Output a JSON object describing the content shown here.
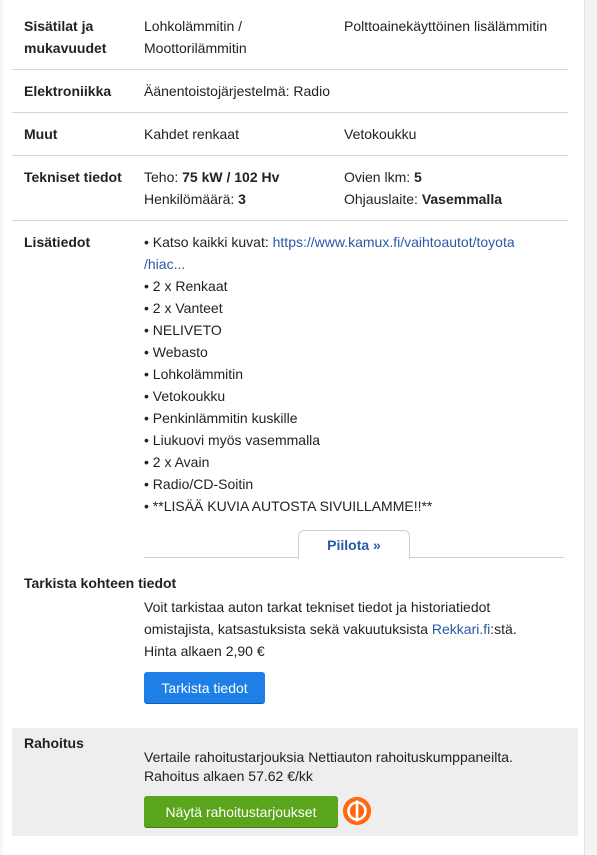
{
  "specs": {
    "interior": {
      "label_line1": "Sisätilat ja",
      "label_line2": "mukavuudet",
      "col1_line1": "Lohkolämmitin /",
      "col1_line2": "Moottorilämmitin",
      "col2": "Polttoainekäyttöinen lisälämmitin"
    },
    "electronics": {
      "label": "Elektroniikka",
      "value": "Äänentoistojärjestelmä: Radio"
    },
    "misc": {
      "label": "Muut",
      "col1": "Kahdet renkaat",
      "col2": "Vetokoukku"
    },
    "technical": {
      "label": "Tekniset tiedot",
      "power_label": "Teho:",
      "power_value": "75 kW / 102 Hv",
      "doors_label": "Ovien lkm:",
      "doors_value": "5",
      "persons_label": "Henkilömäärä:",
      "persons_value": "3",
      "steering_label": "Ohjauslaite:",
      "steering_value": "Vasemmalla"
    },
    "extra": {
      "label": "Lisätiedot",
      "link_prefix": "• Katso kaikki kuvat: ",
      "link_line1": "https://www.kamux.fi/vaihtoautot/toyota",
      "link_line2": "/hiac...",
      "items": [
        "• 2 x Renkaat",
        "• 2 x Vanteet",
        "• NELIVETO",
        "• Webasto",
        "• Lohkolämmitin",
        "• Vetokoukku",
        "• Penkinlämmitin kuskille",
        "• Liukuovi myös vasemmalla",
        "• 2 x Avain",
        "• Radio/CD-Soitin",
        "• **LISÄÄ KUVIA AUTOSTA SIVUILLAMME!!**"
      ],
      "hide_tab": "Piilota »"
    }
  },
  "check": {
    "title": "Tarkista kohteen tiedot",
    "line1": "Voit tarkistaa auton tarkat tekniset tiedot ja historiatiedot",
    "line2_prefix": "omistajista, katsastuksista sekä vakuutuksista ",
    "line2_link": "Rekkari.fi",
    "line2_suffix": ":stä.",
    "price": "Hinta alkaen 2,90 €",
    "button": "Tarkista tiedot"
  },
  "finance": {
    "title": "Rahoitus",
    "line1": "Vertaile rahoitustarjouksia Nettiauton rahoituskumppaneilta.",
    "line2": "Rahoitus alkaen 57.62 €/kk",
    "button": "Näytä rahoitustarjoukset",
    "logo_icon": "op-bank-logo-icon",
    "logo_color": "#ff6a10",
    "button_color": "#5aa51c",
    "check_button_color": "#1e7fe6"
  }
}
